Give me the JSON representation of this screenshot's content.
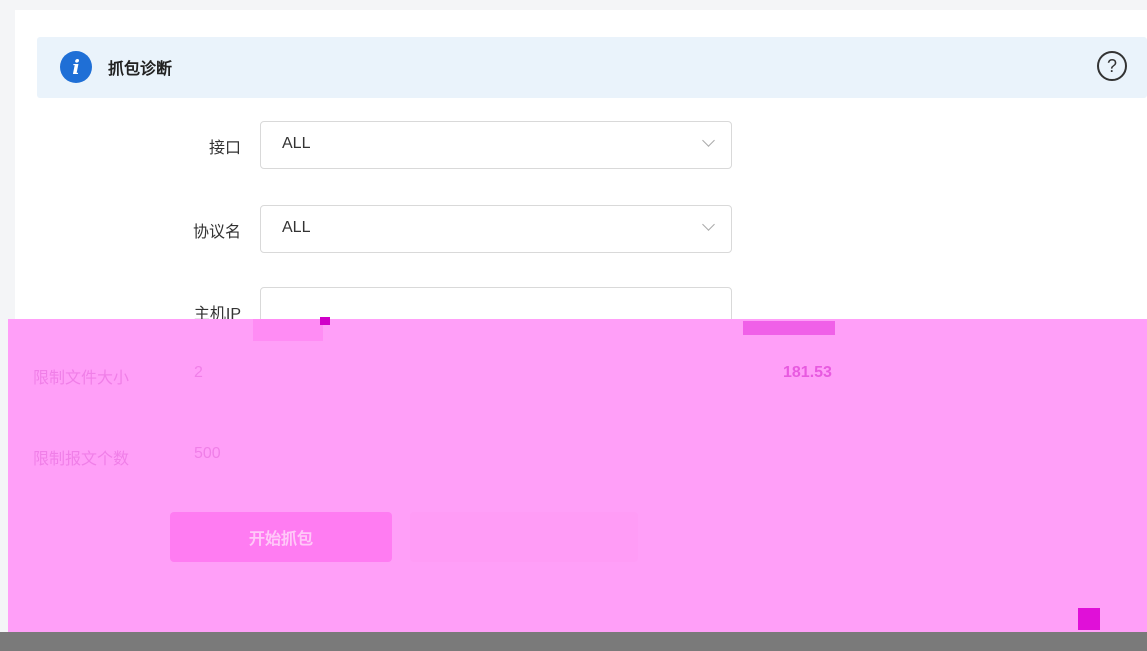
{
  "header": {
    "title": "抓包诊断",
    "info_icon": "info-icon",
    "help_icon": "help-icon",
    "help_glyph": "?",
    "info_glyph": "i"
  },
  "form": {
    "interface": {
      "label": "接口",
      "value": "ALL"
    },
    "protocol": {
      "label": "协议名",
      "value": "ALL"
    },
    "host_ip": {
      "label": "主机IP",
      "value": ""
    },
    "file_size_limit": {
      "label": "限制文件大小",
      "value": "2"
    },
    "packet_count_limit": {
      "label": "限制报文个数",
      "value": "500"
    },
    "available": {
      "value": "181.53"
    }
  },
  "actions": {
    "start_label": "开始抓包"
  },
  "colors": {
    "accent": "#1f6fd6",
    "overlay": "#ff9ff8",
    "info_bg": "#eaf3fb"
  }
}
